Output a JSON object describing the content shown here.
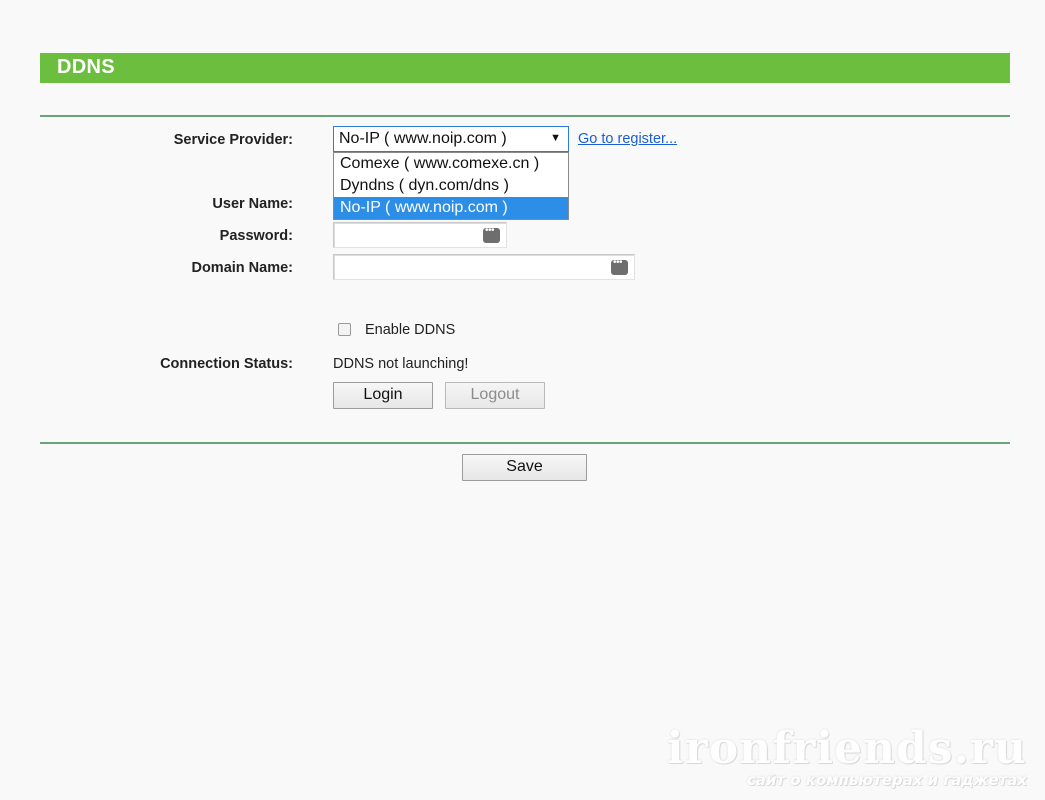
{
  "header": {
    "title": "DDNS"
  },
  "form": {
    "service_provider": {
      "label": "Service Provider:",
      "selected": "No-IP ( www.noip.com )",
      "arrow_icon": "triangle-down-icon",
      "options": [
        "Comexe ( www.comexe.cn )",
        "Dyndns ( dyn.com/dns )",
        "No-IP ( www.noip.com )"
      ],
      "selected_index": 2,
      "register_link": "Go to register..."
    },
    "user_name": {
      "label": "User Name:",
      "value": ""
    },
    "password": {
      "label": "Password:",
      "value": "",
      "icon": "password-key-icon"
    },
    "domain_name": {
      "label": "Domain Name:",
      "value": "",
      "icon": "password-key-icon"
    },
    "enable_ddns": {
      "label": "Enable DDNS",
      "checked": false
    },
    "connection_status": {
      "label": "Connection Status:",
      "value": "DDNS not launching!"
    },
    "login_button": "Login",
    "logout_button": "Logout",
    "save_button": "Save"
  },
  "colors": {
    "header_bg": "#6cbe3f",
    "rule": "#6aa47b",
    "selected_option_bg": "#2d8ee8",
    "link": "#1a5fd1"
  },
  "watermark": {
    "main": "ironfriends.ru",
    "sub": "сайт о компьютерах и гаджетах"
  }
}
